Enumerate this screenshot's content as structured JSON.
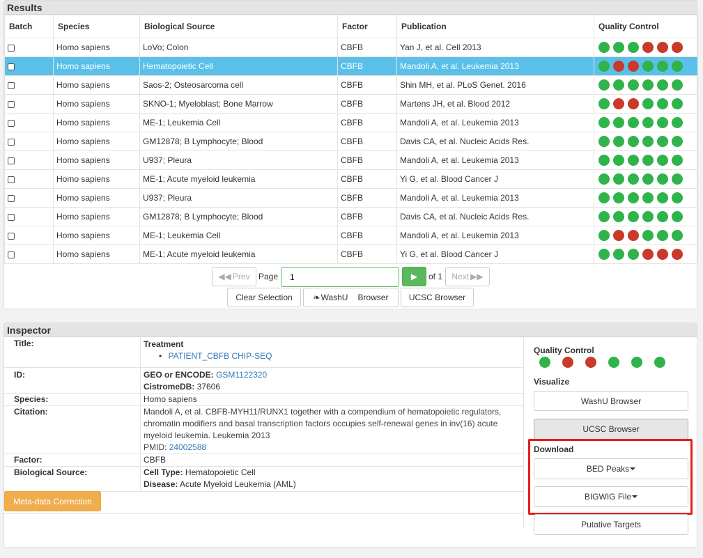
{
  "results": {
    "title": "Results",
    "columns": [
      "Batch",
      "Species",
      "Biological Source",
      "Factor",
      "Publication",
      "Quality Control"
    ],
    "rows": [
      {
        "species": "Homo sapiens",
        "source": "LoVo; Colon",
        "factor": "CBFB",
        "publication": "Yan J, et al. Cell 2013",
        "qc": [
          "g",
          "g",
          "g",
          "r",
          "r",
          "r"
        ]
      },
      {
        "species": "Homo sapiens",
        "source": "Hematopoietic Cell",
        "factor": "CBFB",
        "publication": "Mandoli A, et al. Leukemia 2013",
        "qc": [
          "g",
          "r",
          "r",
          "g",
          "g",
          "g"
        ]
      },
      {
        "species": "Homo sapiens",
        "source": "Saos-2; Osteosarcoma cell",
        "factor": "CBFB",
        "publication": "Shin MH, et al. PLoS Genet. 2016",
        "qc": [
          "g",
          "g",
          "g",
          "g",
          "g",
          "g"
        ]
      },
      {
        "species": "Homo sapiens",
        "source": "SKNO-1; Myeloblast; Bone Marrow",
        "factor": "CBFB",
        "publication": "Martens JH, et al. Blood 2012",
        "qc": [
          "g",
          "r",
          "r",
          "g",
          "g",
          "g"
        ]
      },
      {
        "species": "Homo sapiens",
        "source": "ME-1; Leukemia Cell",
        "factor": "CBFB",
        "publication": "Mandoli A, et al. Leukemia 2013",
        "qc": [
          "g",
          "g",
          "g",
          "g",
          "g",
          "g"
        ]
      },
      {
        "species": "Homo sapiens",
        "source": "GM12878; B Lymphocyte; Blood",
        "factor": "CBFB",
        "publication": "Davis CA, et al. Nucleic Acids Res.",
        "qc": [
          "g",
          "g",
          "g",
          "g",
          "g",
          "g"
        ]
      },
      {
        "species": "Homo sapiens",
        "source": "U937; Pleura",
        "factor": "CBFB",
        "publication": "Mandoli A, et al. Leukemia 2013",
        "qc": [
          "g",
          "g",
          "g",
          "g",
          "g",
          "g"
        ]
      },
      {
        "species": "Homo sapiens",
        "source": "ME-1; Acute myeloid leukemia",
        "factor": "CBFB",
        "publication": "Yi G, et al. Blood Cancer J",
        "qc": [
          "g",
          "g",
          "g",
          "g",
          "g",
          "g"
        ]
      },
      {
        "species": "Homo sapiens",
        "source": "U937; Pleura",
        "factor": "CBFB",
        "publication": "Mandoli A, et al. Leukemia 2013",
        "qc": [
          "g",
          "g",
          "g",
          "g",
          "g",
          "g"
        ]
      },
      {
        "species": "Homo sapiens",
        "source": "GM12878; B Lymphocyte; Blood",
        "factor": "CBFB",
        "publication": "Davis CA, et al. Nucleic Acids Res.",
        "qc": [
          "g",
          "g",
          "g",
          "g",
          "g",
          "g"
        ]
      },
      {
        "species": "Homo sapiens",
        "source": "ME-1; Leukemia Cell",
        "factor": "CBFB",
        "publication": "Mandoli A, et al. Leukemia 2013",
        "qc": [
          "g",
          "r",
          "r",
          "g",
          "g",
          "g"
        ]
      },
      {
        "species": "Homo sapiens",
        "source": "ME-1; Acute myeloid leukemia",
        "factor": "CBFB",
        "publication": "Yi G, et al. Blood Cancer J",
        "qc": [
          "g",
          "g",
          "g",
          "r",
          "r",
          "r"
        ]
      }
    ],
    "selected_row": 1,
    "pager": {
      "prev": "Prev",
      "page_label": "Page",
      "page_value": "1",
      "of_label": "of 1",
      "next": "Next"
    },
    "buttons": {
      "clear": "Clear Selection",
      "washu": "WashU",
      "washu_browser": "Browser",
      "ucsc": "UCSC Browser"
    }
  },
  "inspector": {
    "title": "Inspector",
    "labels": {
      "title": "Title:",
      "id": "ID:",
      "species": "Species:",
      "citation": "Citation:",
      "factor": "Factor:",
      "bio_source": "Biological Source:"
    },
    "treatment_label": "Treatment",
    "treatment_item": "PATIENT_CBFB CHIP-SEQ",
    "geo_label": "GEO or ENCODE:",
    "geo_value": "GSM1122320",
    "cistrome_label": "CistromeDB:",
    "cistrome_value": "37606",
    "species": "Homo sapiens",
    "citation": "Mandoli A, et al. CBFB-MYH11/RUNX1 together with a compendium of hematopoietic regulators, chromatin modifiers and basal transcription factors occupies self-renewal genes in inv(16) acute myeloid leukemia. Leukemia 2013",
    "pmid_label": "PMID:",
    "pmid_value": "24002588",
    "factor": "CBFB",
    "cell_type_label": "Cell Type:",
    "cell_type": "Hematopoietic Cell",
    "disease_label": "Disease:",
    "disease": "Acute Myeloid Leukemia (AML)",
    "metadata_button": "Meta-data Correction",
    "side": {
      "qc_title": "Quality Control",
      "qc": [
        "g",
        "r",
        "r",
        "g",
        "g",
        "g"
      ],
      "visualize_title": "Visualize",
      "washu_button": "WashU Browser",
      "ucsc_button": "UCSC Browser",
      "download_title": "Download",
      "bed_button": "BED Peaks",
      "bigwig_button": "BIGWIG File",
      "targets_button": "Putative Targets"
    }
  },
  "colors": {
    "selected_row": "#5bc0e9",
    "qc_pass": "#2fb34a",
    "qc_fail": "#c83a2a",
    "highlight_box": "#e3201b",
    "link": "#337ab7",
    "go_button": "#5cb85c",
    "metadata_button": "#f0ad4e"
  }
}
